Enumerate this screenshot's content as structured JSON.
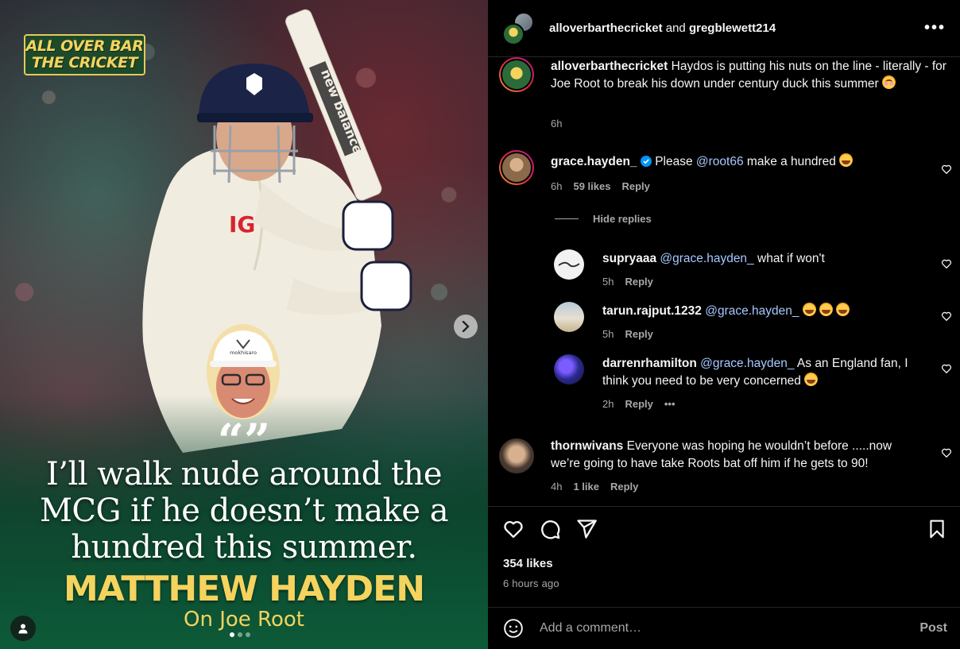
{
  "media": {
    "brand_line1": "ALL OVER BAR",
    "brand_line2": "THE CRICKET",
    "quote_mark": "“”",
    "quote": "I’ll walk nude around the MCG if he doesn’t make a hundred this summer.",
    "author": "MATTHEW HAYDEN",
    "subtitle": "On Joe Root",
    "bat_text": "new balance",
    "sponsor": "IG",
    "cap_brand": "mokhisaro",
    "carousel": {
      "total": 3,
      "active": 1
    }
  },
  "header": {
    "account1": "alloverbarthecricket",
    "connector": "and",
    "account2": "gregblewett214",
    "more_label": "•••"
  },
  "caption": {
    "user": "alloverbarthecricket",
    "text": "Haydos is putting his nuts on the line - literally - for Joe Root to break his down under century duck this summer",
    "emoji": "flush",
    "time": "6h"
  },
  "comments": [
    {
      "user": "grace.hayden_",
      "verified": true,
      "pre": "Please",
      "mention": "@root66",
      "text": "make a hundred",
      "emoji": "laugh",
      "time": "6h",
      "likes": "59 likes",
      "reply": "Reply"
    }
  ],
  "hide_replies": "Hide replies",
  "replies": [
    {
      "user": "supryaaa",
      "mention": "@grace.hayden_",
      "text": "what if won't",
      "time": "5h",
      "reply": "Reply"
    },
    {
      "user": "tarun.rajput.1232",
      "mention": "@grace.hayden_",
      "text": "",
      "time": "5h",
      "reply": "Reply"
    },
    {
      "user": "darrenrhamilton",
      "mention": "@grace.hayden_",
      "text": "As an England fan, I think you need to be very concerned",
      "time": "2h",
      "reply": "Reply",
      "more": "•••"
    }
  ],
  "comment2": {
    "user": "thornwivans",
    "text": "Everyone was hoping he wouldn’t before .....now we’re going to have take Roots bat off him if he gets to 90!",
    "time": "4h",
    "likes": "1 like",
    "reply": "Reply"
  },
  "stats": {
    "likes": "354 likes",
    "time_ago": "6 hours ago"
  },
  "composer": {
    "placeholder": "Add a comment…",
    "post_label": "Post"
  },
  "colors": {
    "background": "#000000",
    "muted": "#a8a8a8",
    "mention": "#a6c8ff",
    "verified": "#0095f6",
    "gold": "#f4d35e"
  }
}
